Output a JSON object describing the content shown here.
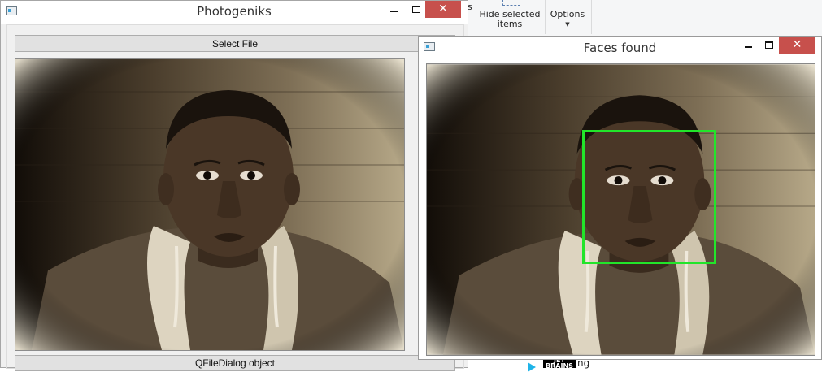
{
  "background_app": {
    "truncated_label": "ns",
    "hide_selected_label": "Hide selected items",
    "options_label": "Options",
    "logo_text": "JET BRAINS",
    "partial_text": "ng"
  },
  "main_window": {
    "title": "Photogeniks",
    "select_file_label": "Select File",
    "qfiledialog_label": "QFileDialog object",
    "close_glyph": "✕"
  },
  "faces_window": {
    "title": "Faces found",
    "close_glyph": "✕",
    "detection_box_color": "#22e52a"
  },
  "colors": {
    "close_button": "#c7504c",
    "sepia_light": "#d6ccb6",
    "sepia_dark": "#1e1710"
  }
}
